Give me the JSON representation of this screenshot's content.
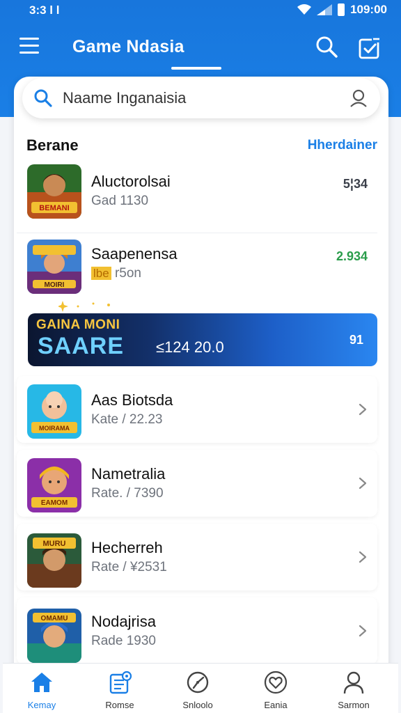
{
  "status_bar": {
    "left_time": "3:3 l l",
    "right_time": "109:00"
  },
  "app_bar": {
    "title": "Game Ndasia"
  },
  "search": {
    "value": "Naame Inganaisia"
  },
  "section": {
    "title": "Berane",
    "link": "Hherdainer"
  },
  "list_items": [
    {
      "title": "Aluctorolsai",
      "subtitle": "Gad 1130",
      "value": "5¦34",
      "thumb_caption": "BEMANI"
    },
    {
      "title": "Saapenensa",
      "subtitle": "r5on",
      "tag": "lbe",
      "value": "2.934",
      "thumb_caption": "MOIRI"
    },
    {
      "title": "Aas Biotsda",
      "subtitle": "Kate  / 22.23",
      "thumb_caption": "MOIRAMA"
    },
    {
      "title": "Nametralia",
      "subtitle": "Rate. / 7390",
      "thumb_caption": "EAMOM"
    },
    {
      "title": "Hecherreh",
      "subtitle": "Rate  / ¥2531",
      "thumb_caption": "MURU"
    },
    {
      "title": "Nodajrisa",
      "subtitle": "Rade 1930",
      "thumb_caption": "OMAMU"
    }
  ],
  "banner": {
    "line1": "GAINA MONI",
    "line2": "SAARE",
    "amount": "≤124 20.0",
    "badge": "91"
  },
  "bottom_nav": [
    {
      "label": "Kemay",
      "icon": "home-icon",
      "active": true
    },
    {
      "label": "Romse",
      "icon": "list-icon",
      "active": false
    },
    {
      "label": "Snloolo",
      "icon": "compass-icon",
      "active": false
    },
    {
      "label": "Eania",
      "icon": "heart-icon",
      "active": false
    },
    {
      "label": "Sarmon",
      "icon": "user-icon",
      "active": false
    }
  ],
  "colors": {
    "primary": "#1a7fe6",
    "background": "#f3f5f9",
    "card": "#ffffff",
    "value_green": "#2a9d4b"
  }
}
